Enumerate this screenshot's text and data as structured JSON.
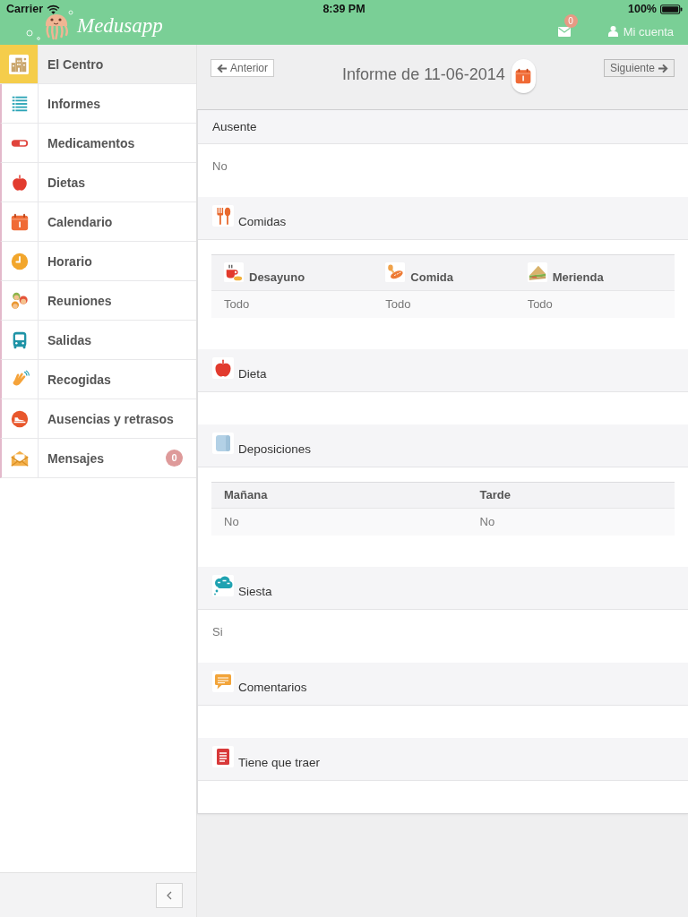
{
  "status_bar": {
    "carrier": "Carrier",
    "time": "8:39 PM",
    "battery": "100%"
  },
  "app_bar": {
    "logo": "Medusapp",
    "messages_badge": "0",
    "account": "Mi cuenta"
  },
  "sidebar": {
    "items": [
      {
        "label": "El Centro",
        "selected": true
      },
      {
        "label": "Informes",
        "selected": false
      },
      {
        "label": "Medicamentos",
        "selected": false
      },
      {
        "label": "Dietas",
        "selected": false
      },
      {
        "label": "Calendario",
        "selected": false
      },
      {
        "label": "Horario",
        "selected": false
      },
      {
        "label": "Reuniones",
        "selected": false
      },
      {
        "label": "Salidas",
        "selected": false
      },
      {
        "label": "Recogidas",
        "selected": false
      },
      {
        "label": "Ausencias y retrasos",
        "selected": false
      },
      {
        "label": "Mensajes",
        "selected": false,
        "badge": "0"
      }
    ]
  },
  "report": {
    "previous": "Anterior",
    "title": "Informe de 11-06-2014",
    "next": "Siguiente",
    "sections": [
      {
        "kind": "value",
        "title": "Ausente",
        "value": "No"
      },
      {
        "kind": "table",
        "title": "Comidas",
        "columns": [
          "Desayuno",
          "Comida",
          "Merienda"
        ],
        "rows": [
          [
            "Todo",
            "Todo",
            "Todo"
          ]
        ]
      },
      {
        "kind": "empty",
        "title": "Dieta"
      },
      {
        "kind": "table",
        "title": "Deposiciones",
        "columns": [
          "Mañana",
          "Tarde"
        ],
        "rows": [
          [
            "No",
            "No"
          ]
        ]
      },
      {
        "kind": "value",
        "title": "Siesta",
        "value": "Si"
      },
      {
        "kind": "empty",
        "title": "Comentarios"
      },
      {
        "kind": "empty",
        "title": "Tiene que traer"
      }
    ]
  }
}
